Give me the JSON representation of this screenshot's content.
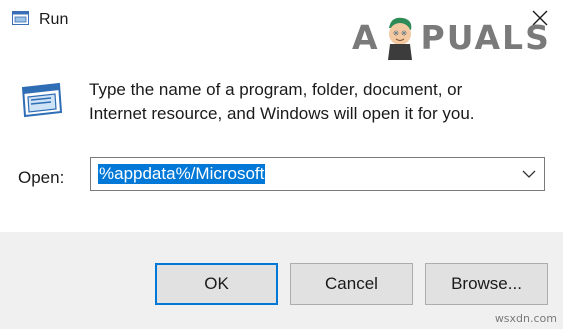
{
  "window": {
    "title": "Run",
    "close_icon": "close-icon",
    "app_icon": "run-app-icon"
  },
  "watermark": {
    "logo_lead": "A",
    "logo_tail": "PUALS",
    "site": "wsxdn.com"
  },
  "body": {
    "description_line1": "Type the name of a program, folder, document, or",
    "description_line2": "Internet resource, and Windows will open it for you.",
    "open_label": "Open:",
    "open_value": "%appdata%/Microsoft",
    "dropdown_icon": "chevron-down-icon"
  },
  "buttons": {
    "ok": "OK",
    "cancel": "Cancel",
    "browse": "Browse..."
  },
  "colors": {
    "accent": "#0078d7",
    "footer_bg": "#f0f0f0",
    "button_bg": "#e1e1e1"
  }
}
